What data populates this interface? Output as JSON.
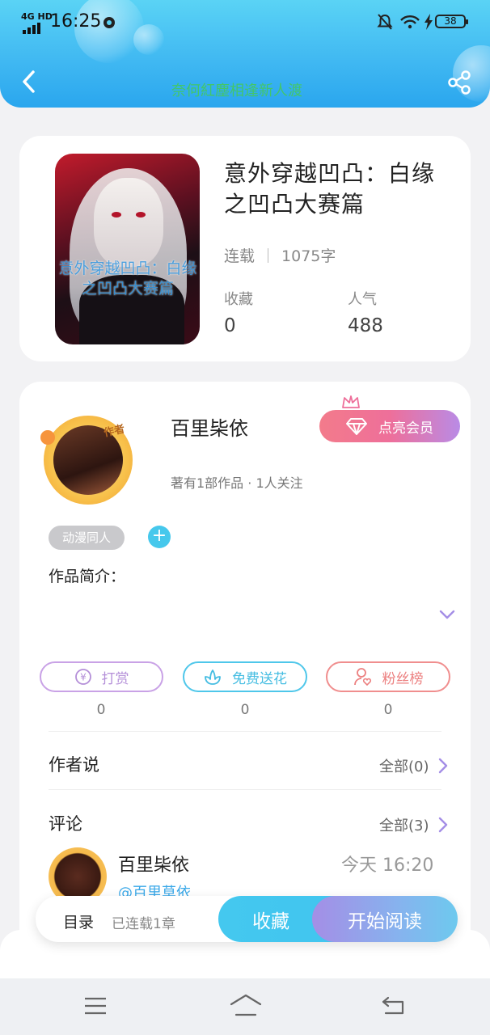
{
  "status_bar": {
    "time": "16:25",
    "network": "4G HD",
    "battery": "38"
  },
  "header": {
    "marquee_text": "奈何紅塵相逢新人渡"
  },
  "book": {
    "title": "意外穿越凹凸：白缘之凹凸大赛篇",
    "cover_overlay": "意外穿越凹凸：白缘之凹凸大赛篇",
    "status": "连载",
    "word_count": "1075字",
    "stats": [
      {
        "label": "收藏",
        "value": "0"
      },
      {
        "label": "人气",
        "value": "488"
      }
    ]
  },
  "author": {
    "name": "百里枈依",
    "sub": "著有1部作品 · 1人关注",
    "avatar_tag": "作者",
    "vip_label": "点亮会员",
    "tag": "动漫同人",
    "plus": "+",
    "intro_label": "作品简介："
  },
  "actions": [
    {
      "label": "打赏",
      "count": "0",
      "color": "#c9a2e6",
      "icon": "yen-coin-icon"
    },
    {
      "label": "免费送花",
      "count": "0",
      "color": "#4fc7ea",
      "icon": "flower-icon"
    },
    {
      "label": "粉丝榜",
      "count": "0",
      "color": "#f08e8e",
      "icon": "fan-user-icon"
    }
  ],
  "author_says": {
    "label": "作者说",
    "more": "全部(0)"
  },
  "comments": {
    "label": "评论",
    "more": "全部(3)",
    "items": [
      {
        "name": "百里枈依",
        "time": "今天 16:20",
        "mention": "@百里草依"
      }
    ]
  },
  "bottom_bar": {
    "toc_label": "目录",
    "toc_status": "已连载1章",
    "favorite_label": "收藏",
    "read_label": "开始阅读"
  },
  "colors": {
    "accent_blue": "#41b9f2",
    "vip_pink": "#ee6f9a",
    "purple": "#a48ee6"
  }
}
